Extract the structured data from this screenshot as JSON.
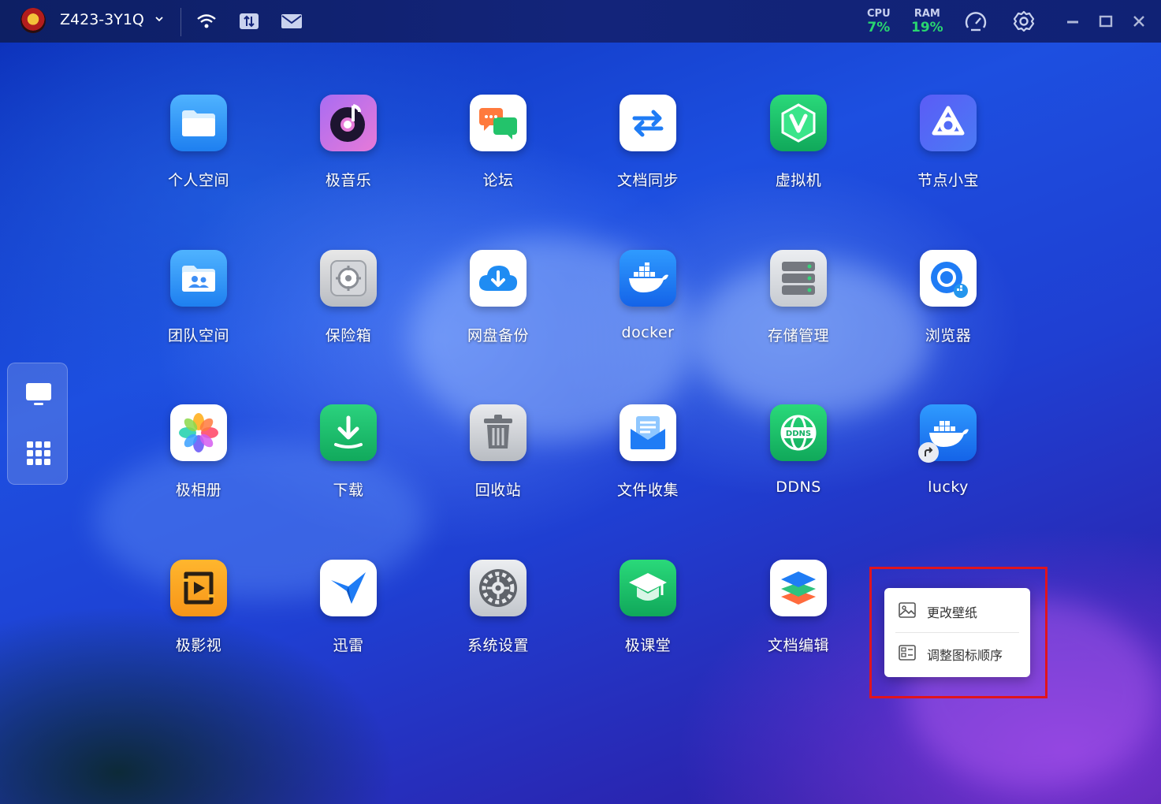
{
  "topbar": {
    "device_name": "Z423-3Y1Q",
    "icons": [
      "avatar",
      "chevron-down-icon",
      "wifi-icon",
      "transfer-icon",
      "mail-icon"
    ],
    "cpu_label": "CPU",
    "cpu_value": "7%",
    "ram_label": "RAM",
    "ram_value": "19%",
    "stat_color": "#29d66f"
  },
  "dock": {
    "items": [
      "desktop-icon",
      "app-grid-icon"
    ]
  },
  "apps": [
    {
      "label": "个人空间",
      "icon": "folder-icon"
    },
    {
      "label": "极音乐",
      "icon": "music-disc-icon"
    },
    {
      "label": "论坛",
      "icon": "forum-chat-icon"
    },
    {
      "label": "文档同步",
      "icon": "sync-arrows-icon"
    },
    {
      "label": "虚拟机",
      "icon": "vm-hexagon-icon"
    },
    {
      "label": "节点小宝",
      "icon": "node-knot-icon"
    },
    {
      "label": "团队空间",
      "icon": "team-folder-icon"
    },
    {
      "label": "保险箱",
      "icon": "safe-icon"
    },
    {
      "label": "网盘备份",
      "icon": "cloud-backup-icon"
    },
    {
      "label": "docker",
      "icon": "docker-whale-icon"
    },
    {
      "label": "存储管理",
      "icon": "storage-server-icon"
    },
    {
      "label": "浏览器",
      "icon": "browser-icon"
    },
    {
      "label": "极相册",
      "icon": "photo-flower-icon"
    },
    {
      "label": "下载",
      "icon": "download-icon"
    },
    {
      "label": "回收站",
      "icon": "trash-icon"
    },
    {
      "label": "文件收集",
      "icon": "file-collect-icon"
    },
    {
      "label": "DDNS",
      "icon": "ddns-globe-icon"
    },
    {
      "label": "lucky",
      "icon": "docker-shortcut-icon"
    },
    {
      "label": "极影视",
      "icon": "video-icon"
    },
    {
      "label": "迅雷",
      "icon": "thunder-bird-icon"
    },
    {
      "label": "系统设置",
      "icon": "settings-gear-icon"
    },
    {
      "label": "极课堂",
      "icon": "graduation-cap-icon"
    },
    {
      "label": "文档编辑",
      "icon": "layers-icon"
    }
  ],
  "context_menu": {
    "items": [
      {
        "label": "更改壁纸",
        "icon": "wallpaper-icon"
      },
      {
        "label": "调整图标顺序",
        "icon": "icon-order-icon"
      }
    ],
    "highlight_color": "#e0141e"
  }
}
